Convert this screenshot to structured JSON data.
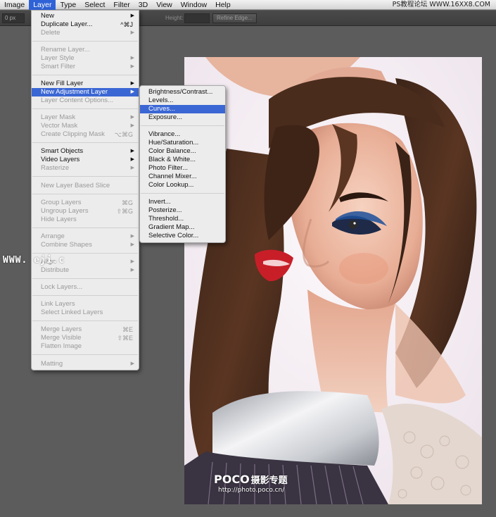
{
  "menubar": {
    "items": [
      "Image",
      "Layer",
      "Type",
      "Select",
      "Filter",
      "3D",
      "View",
      "Window",
      "Help"
    ],
    "active": "Layer",
    "watermark": "PS教程论坛 WWW.16XX8.COM"
  },
  "options_bar": {
    "x_value": "0 px",
    "height_label": "Height:",
    "refine_edge": "Refine Edge..."
  },
  "layer_menu": {
    "new": "New",
    "duplicate_layer": "Duplicate Layer...",
    "duplicate_shortcut": "^⌘J",
    "delete": "Delete",
    "rename_layer": "Rename Layer...",
    "layer_style": "Layer Style",
    "smart_filter": "Smart Filter",
    "new_fill_layer": "New Fill Layer",
    "new_adjustment_layer": "New Adjustment Layer",
    "layer_content_options": "Layer Content Options...",
    "layer_mask": "Layer Mask",
    "vector_mask": "Vector Mask",
    "create_clipping_mask": "Create Clipping Mask",
    "clipping_shortcut": "⌥⌘G",
    "smart_objects": "Smart Objects",
    "video_layers": "Video Layers",
    "rasterize": "Rasterize",
    "new_layer_based_slice": "New Layer Based Slice",
    "group_layers": "Group Layers",
    "group_shortcut": "⌘G",
    "ungroup_layers": "Ungroup Layers",
    "ungroup_shortcut": "⇧⌘G",
    "hide_layers": "Hide Layers",
    "arrange": "Arrange",
    "combine_shapes": "Combine Shapes",
    "align": "Align",
    "distribute": "Distribute",
    "lock_layers": "Lock Layers...",
    "link_layers": "Link Layers",
    "select_linked_layers": "Select Linked Layers",
    "merge_layers": "Merge Layers",
    "merge_shortcut": "⌘E",
    "merge_visible": "Merge Visible",
    "merge_visible_shortcut": "⇧⌘E",
    "flatten_image": "Flatten Image",
    "matting": "Matting"
  },
  "adjustment_submenu": {
    "brightness_contrast": "Brightness/Contrast...",
    "levels": "Levels...",
    "curves": "Curves...",
    "exposure": "Exposure...",
    "vibrance": "Vibrance...",
    "hue_saturation": "Hue/Saturation...",
    "color_balance": "Color Balance...",
    "black_white": "Black & White...",
    "photo_filter": "Photo Filter...",
    "channel_mixer": "Channel Mixer...",
    "color_lookup": "Color Lookup...",
    "invert": "Invert...",
    "posterize": "Posterize...",
    "threshold": "Threshold...",
    "gradient_map": "Gradient Map...",
    "selective_color": "Selective Color..."
  },
  "overlay_watermark": "WWW.            eji.c",
  "photo_caption": {
    "logo": "POCO",
    "logo_cn": "摄影专题",
    "url": "http://photo.poco.cn/"
  },
  "colors": {
    "menu_highlight": "#3b67d4",
    "menubar_active": "#2f62d6",
    "workspace": "#5c5c5c"
  }
}
